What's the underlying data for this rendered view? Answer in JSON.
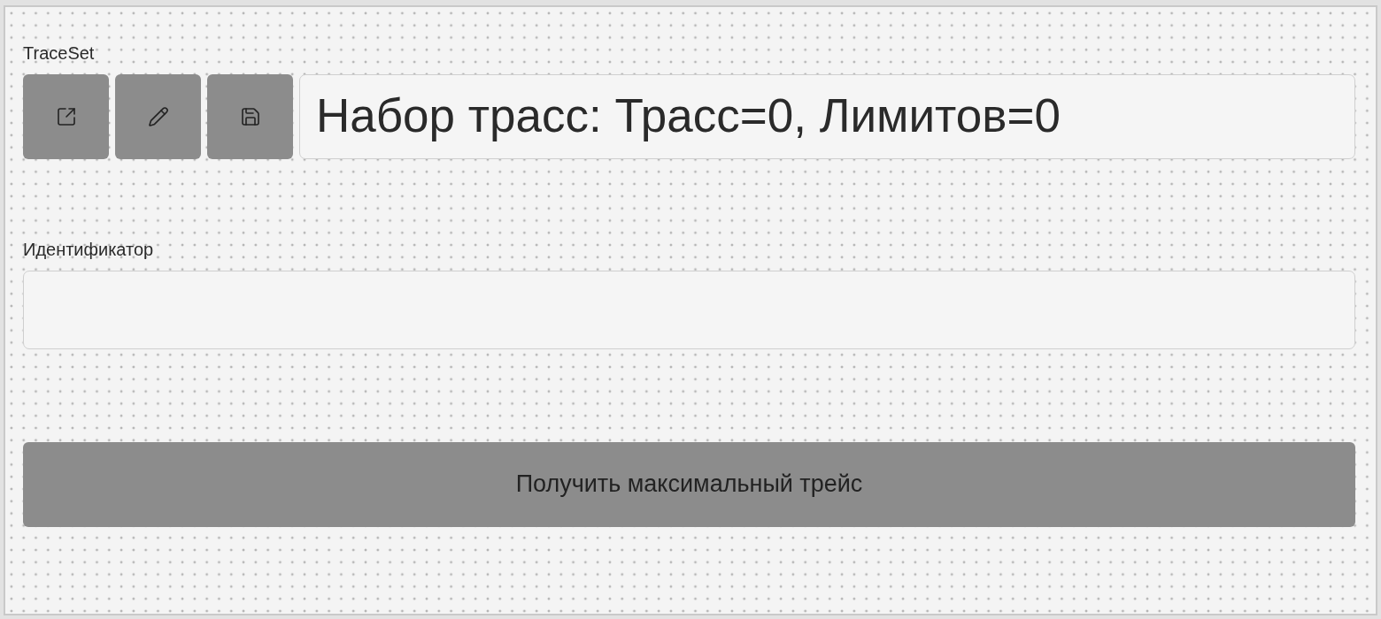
{
  "trace_set": {
    "label": "TraceSet",
    "tool_buttons": [
      {
        "kind": "open"
      },
      {
        "kind": "edit"
      },
      {
        "kind": "save"
      }
    ],
    "value": "Набор трасс: Трасс=0, Лимитов=0"
  },
  "identifier": {
    "label": "Идентификатор"
  },
  "action_button": {
    "label": "Получить максимальный трейс"
  }
}
